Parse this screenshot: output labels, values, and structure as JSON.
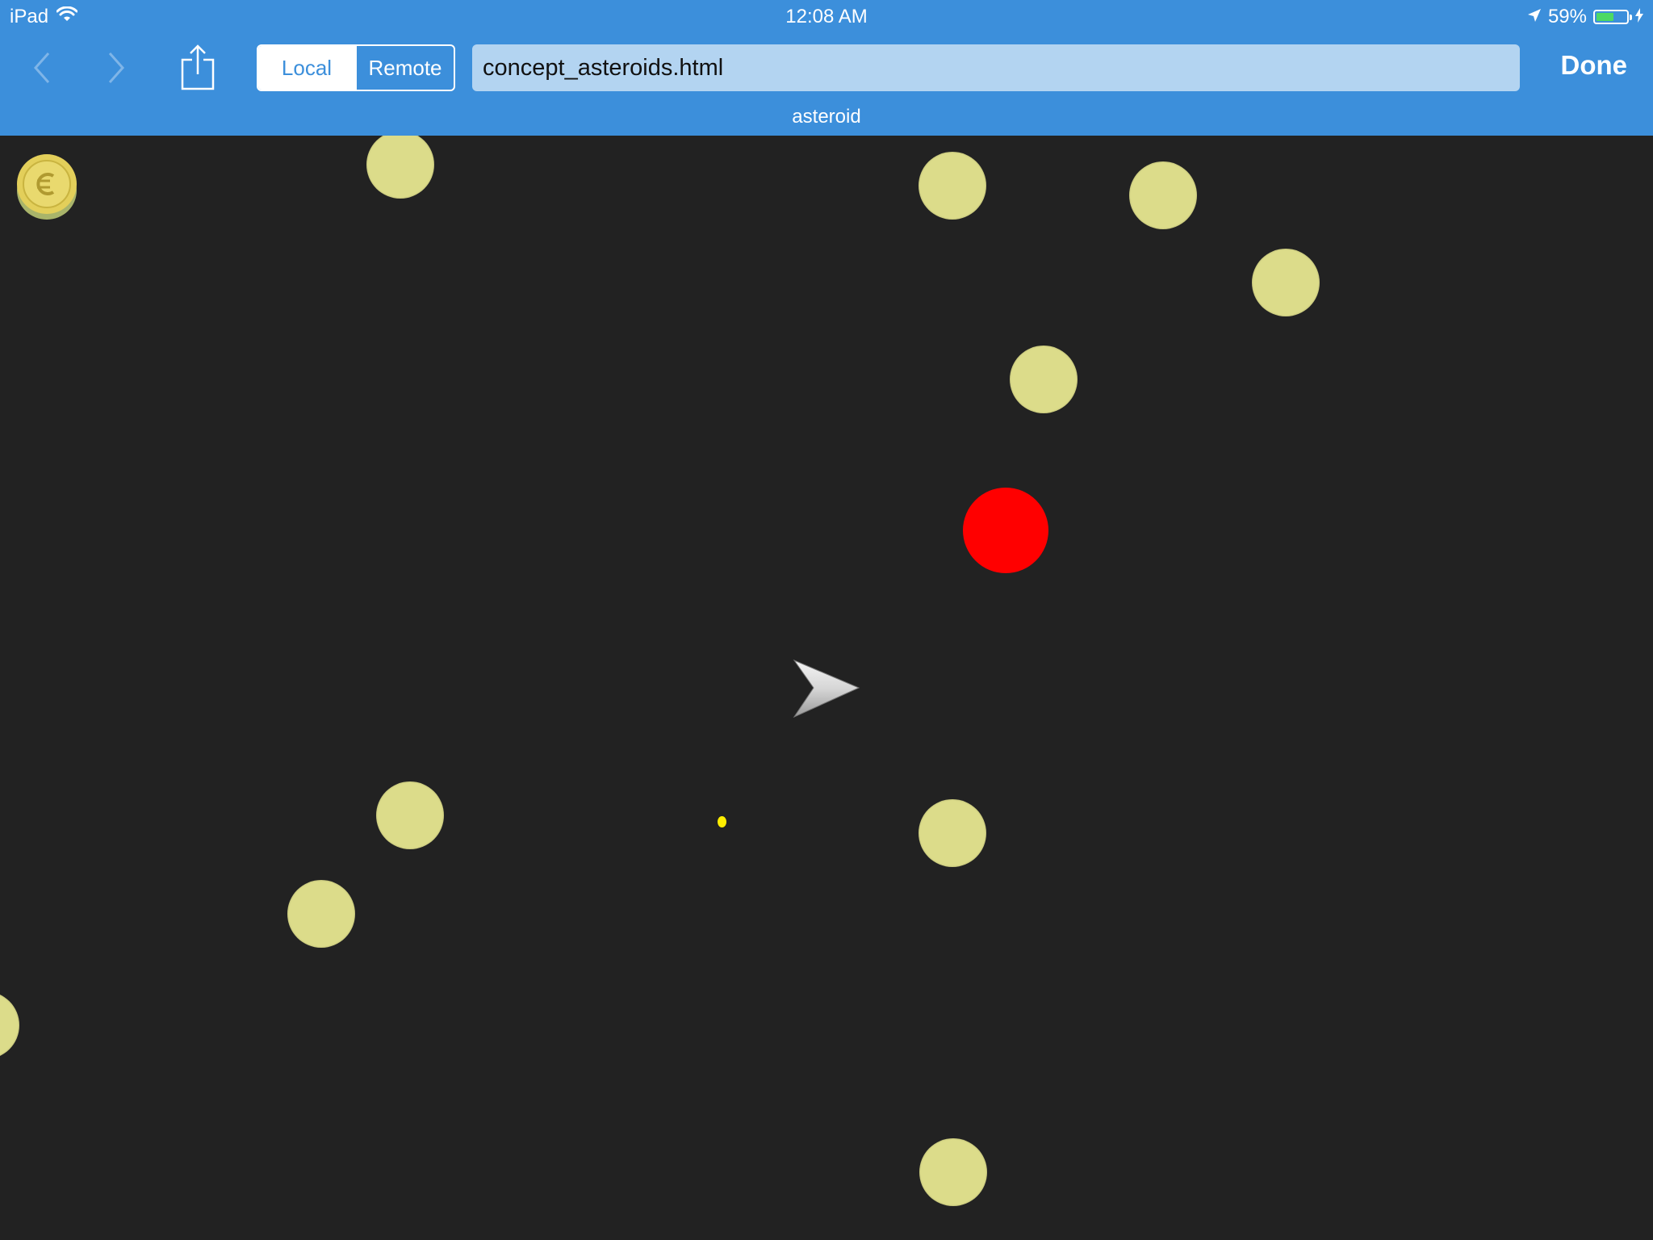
{
  "status_bar": {
    "device": "iPad",
    "time": "12:08 AM",
    "battery": "59%",
    "battery_level": 0.59
  },
  "toolbar": {
    "segments": [
      "Local",
      "Remote"
    ],
    "selected_segment": "Local",
    "url": "concept_asteroids.html",
    "done_label": "Done"
  },
  "page": {
    "title": "asteroid"
  },
  "colors": {
    "toolbar_bg": "#3c8fdb",
    "game_bg": "#222222",
    "asteroid": "#dcdc8a",
    "enemy": "#ff0000",
    "bullet": "#ffee00"
  }
}
